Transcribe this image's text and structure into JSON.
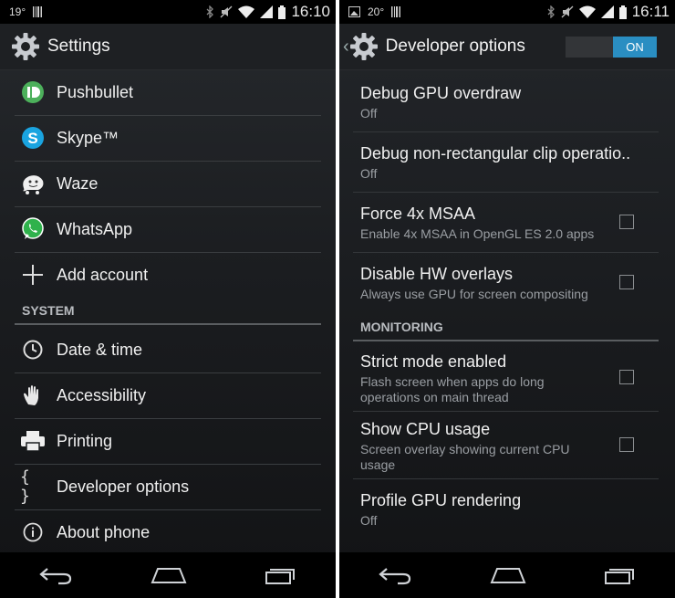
{
  "left": {
    "status": {
      "temp": "19°",
      "time": "16:10"
    },
    "title": "Settings",
    "items": [
      {
        "label": "Pushbullet",
        "icon": "pushbullet-icon"
      },
      {
        "label": "Skype™",
        "icon": "skype-icon"
      },
      {
        "label": "Waze",
        "icon": "waze-icon"
      },
      {
        "label": "WhatsApp",
        "icon": "whatsapp-icon"
      },
      {
        "label": "Add account",
        "icon": "plus-icon"
      }
    ],
    "section": "SYSTEM",
    "system_items": [
      {
        "label": "Date & time",
        "icon": "clock-icon"
      },
      {
        "label": "Accessibility",
        "icon": "hand-icon"
      },
      {
        "label": "Printing",
        "icon": "printer-icon"
      },
      {
        "label": "Developer options",
        "icon": "braces-icon",
        "glyph": "{ }"
      },
      {
        "label": "About phone",
        "icon": "info-icon"
      }
    ]
  },
  "right": {
    "status": {
      "temp": "20°",
      "time": "16:11"
    },
    "title": "Developer options",
    "toggle_label": "ON",
    "items": [
      {
        "title": "Debug GPU overdraw",
        "summary": "Off"
      },
      {
        "title": "Debug non-rectangular clip operatio..",
        "summary": "Off"
      },
      {
        "title": "Force 4x MSAA",
        "summary": "Enable 4x MSAA in OpenGL ES 2.0 apps",
        "checked": false
      },
      {
        "title": "Disable HW overlays",
        "summary": "Always use GPU for screen compositing",
        "checked": false
      }
    ],
    "section": "MONITORING",
    "monitor_items": [
      {
        "title": "Strict mode enabled",
        "summary_lines": [
          "Flash screen when apps do long",
          "operations on main thread"
        ],
        "checked": false
      },
      {
        "title": "Show CPU usage",
        "summary_lines": [
          "Screen overlay showing current CPU",
          "usage"
        ],
        "checked": false
      },
      {
        "title": "Profile GPU rendering",
        "summary": "Off"
      }
    ]
  },
  "colors": {
    "accent": "#2a8ec2",
    "background": "#1b1d20",
    "statusbar": "#000000"
  }
}
